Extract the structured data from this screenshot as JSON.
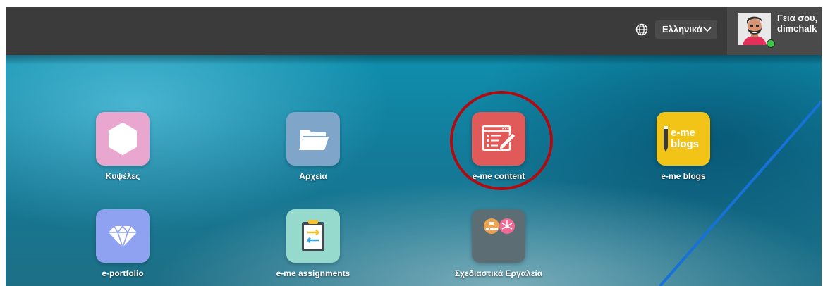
{
  "header": {
    "language_label": "Ελληνικά",
    "greeting_line1": "Γεια σου,",
    "greeting_line2": "dimchalk",
    "status": "online"
  },
  "apps": [
    {
      "label": "Κυψέλες",
      "icon": "hexagon-icon",
      "color": "#e9a6cf"
    },
    {
      "label": "Αρχεία",
      "icon": "folder-icon",
      "color": "#7fa6c9"
    },
    {
      "label": "e-me content",
      "icon": "content-editor-icon",
      "color": "#e05a5a",
      "highlighted": true
    },
    {
      "label": "e-me blogs",
      "icon": "blogs-icon",
      "color": "#f1c417",
      "icon_text_line1": "e-me",
      "icon_text_line2": "blogs"
    },
    {
      "label": "e-portfolio",
      "icon": "diamond-icon",
      "color": "#8fa2f1"
    },
    {
      "label": "e-me assignments",
      "icon": "clipboard-icon",
      "color": "#96d9cd"
    },
    {
      "label": "Σχεδιαστικά Εργαλεία",
      "icon": "design-tools-folder-icon",
      "color": "#5c6d74"
    }
  ],
  "colors": {
    "topbar": "#3b3b3b",
    "highlight_ring": "#b00b10"
  }
}
